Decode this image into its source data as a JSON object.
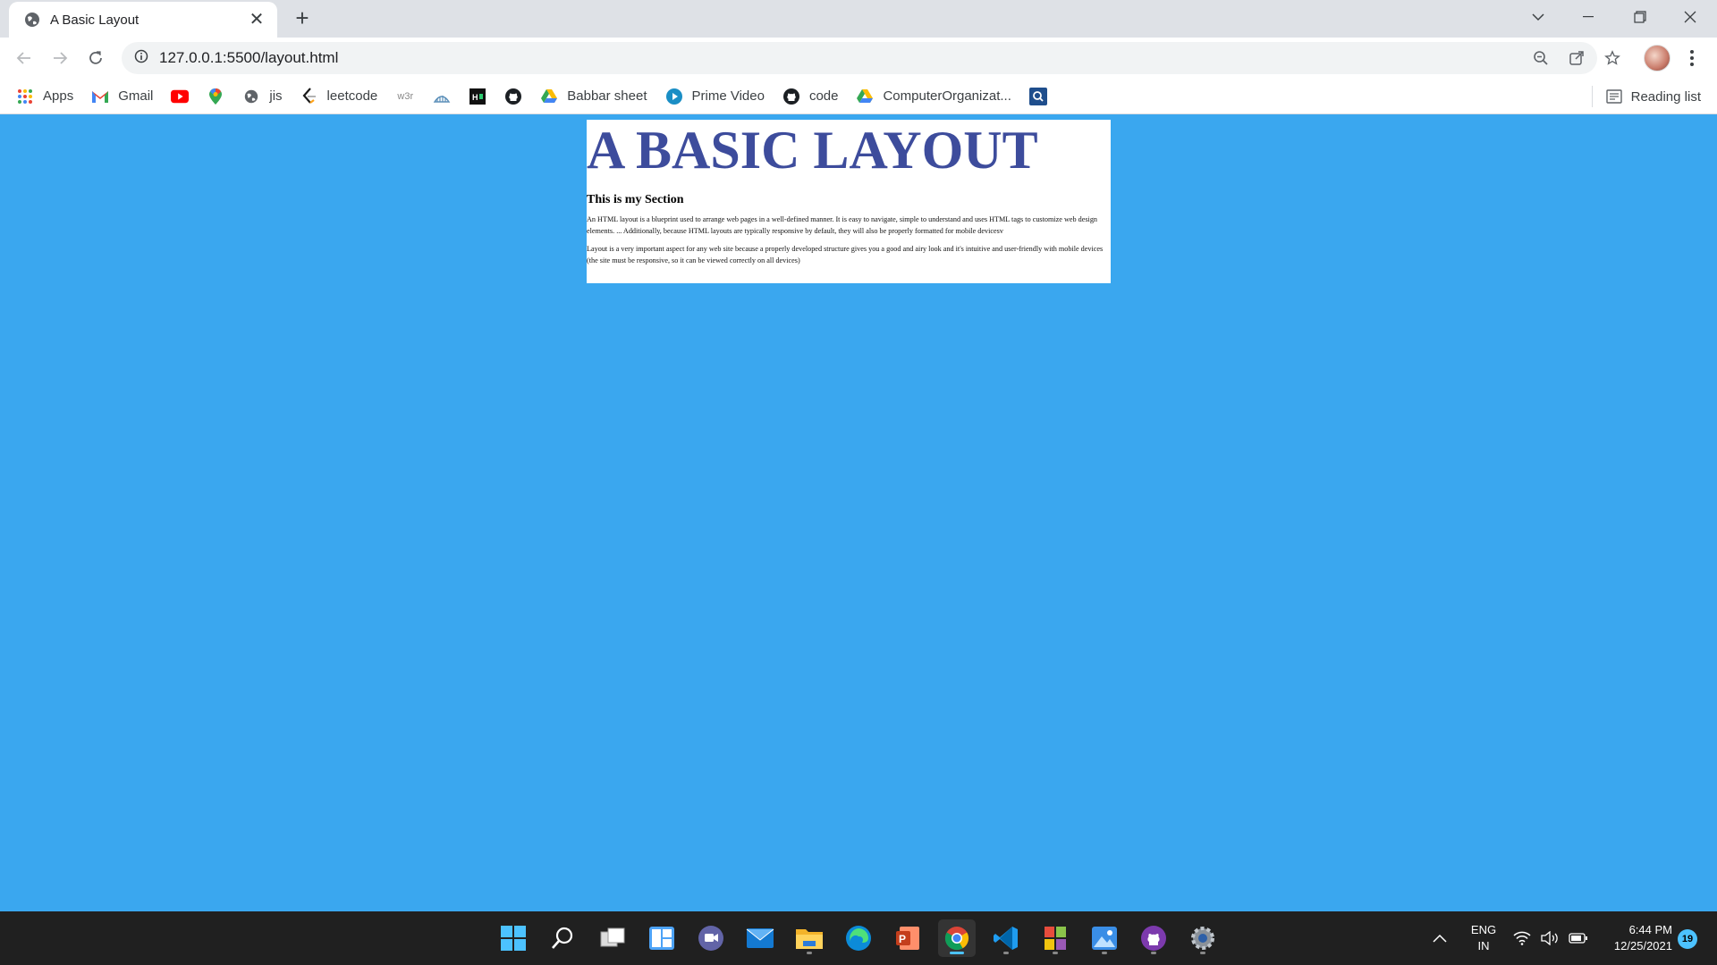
{
  "browser": {
    "tab": {
      "title": "A Basic Layout",
      "close": "✕"
    },
    "new_tab": "+",
    "url": "127.0.0.1:5500/layout.html",
    "bookmarks": [
      {
        "label": "Apps",
        "icon": "apps-grid-icon"
      },
      {
        "label": "Gmail",
        "icon": "gmail-icon"
      },
      {
        "label": "",
        "icon": "youtube-icon"
      },
      {
        "label": "",
        "icon": "maps-icon"
      },
      {
        "label": "jis",
        "icon": "globe-icon"
      },
      {
        "label": "leetcode",
        "icon": "leetcode-icon"
      },
      {
        "label": "",
        "icon": "w3r-icon"
      },
      {
        "label": "",
        "icon": "codechef-icon"
      },
      {
        "label": "",
        "icon": "hackerearth-icon"
      },
      {
        "label": "",
        "icon": "github-icon"
      },
      {
        "label": "Babbar sheet",
        "icon": "google-drive-icon"
      },
      {
        "label": "Prime Video",
        "icon": "prime-video-icon"
      },
      {
        "label": "code",
        "icon": "github-icon"
      },
      {
        "label": "ComputerOrganizat...",
        "icon": "google-drive-icon"
      },
      {
        "label": "",
        "icon": "search-q-icon"
      }
    ],
    "reading_list": "Reading list"
  },
  "page": {
    "heading": "A BASIC LAYOUT",
    "section_title": "This is my Section",
    "paragraph1": "An HTML layout is a blueprint used to arrange web pages in a well-defined manner. It is easy to navigate, simple to understand and uses HTML tags to customize web design elements. ... Additionally, because HTML layouts are typically responsive by default, they will also be properly formatted for mobile devicesv",
    "paragraph2": "Layout is a very important aspect for any web site because a properly developed structure gives you a good and airy look and it's intuitive and user-friendly with mobile devices (the site must be responsive, so it can be viewed correctly on all devices)"
  },
  "taskbar": {
    "apps": [
      "windows-start-icon",
      "search-icon",
      "task-view-icon",
      "widgets-icon",
      "teams-chat-icon",
      "mail-icon",
      "file-explorer-icon",
      "edge-icon",
      "powerpoint-icon",
      "chrome-icon",
      "vscode-icon",
      "office-apps-icon",
      "photos-icon",
      "github-desktop-icon",
      "settings-icon"
    ],
    "lang_line1": "ENG",
    "lang_line2": "IN",
    "time": "6:44 PM",
    "date": "12/25/2021",
    "notifications": "19"
  },
  "colors": {
    "page_bg": "#3aa7ef",
    "heading": "#3d4c9c",
    "taskbar": "#202020"
  }
}
